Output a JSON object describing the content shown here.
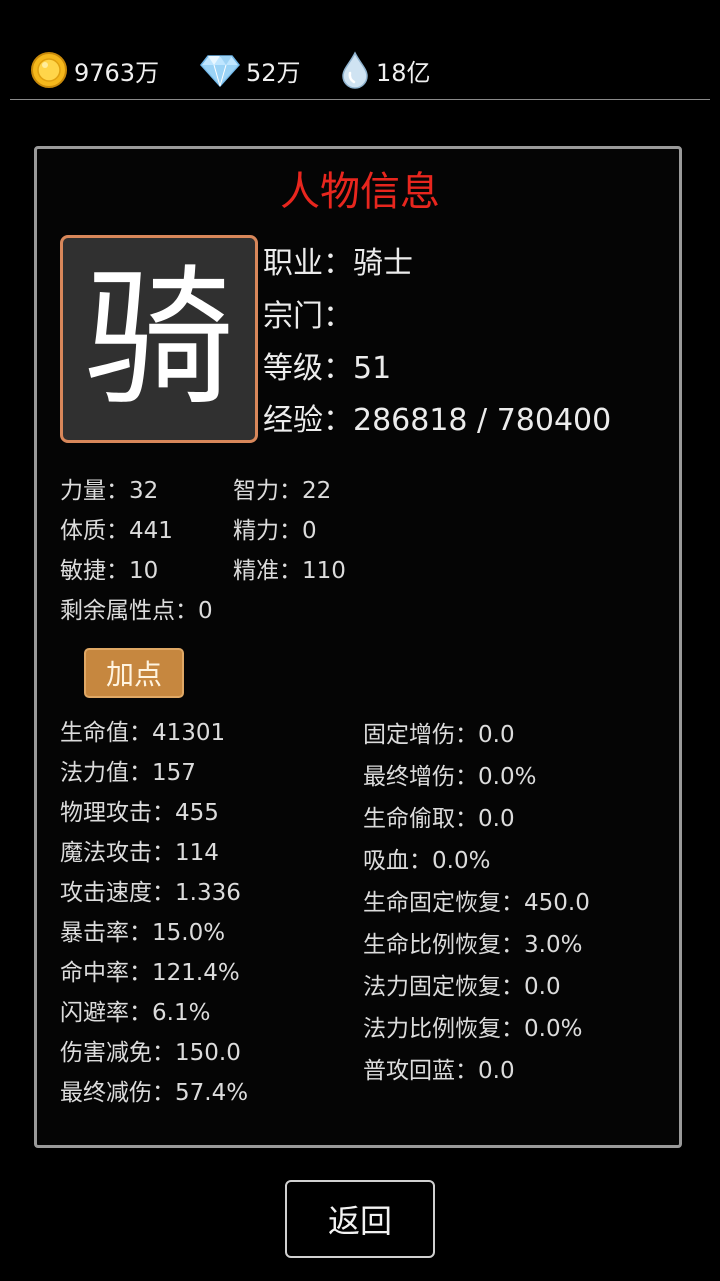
{
  "resources": {
    "gold": "9763万",
    "diamond": "52万",
    "water": "18亿"
  },
  "panel_title": "人物信息",
  "avatar_char": "骑",
  "profile": {
    "job": "职业：骑士",
    "sect": "宗门：",
    "level": "等级：51",
    "exp": "经验：286818 / 780400"
  },
  "attributes": {
    "strength": "力量：32",
    "intelligence": "智力：22",
    "constitution": "体质：441",
    "energy": "精力：0",
    "agility": "敏捷：10",
    "precision": "精准：110",
    "remaining": "剩余属性点：0"
  },
  "add_point_label": "加点",
  "combat_left": [
    "生命值：41301",
    "法力值：157",
    "物理攻击：455",
    "魔法攻击：114",
    "攻击速度：1.336",
    "暴击率：15.0%",
    "命中率：121.4%",
    "闪避率：6.1%",
    "伤害减免：150.0",
    "最终减伤：57.4%"
  ],
  "combat_right": [
    "固定增伤：0.0",
    "最终增伤：0.0%",
    "生命偷取：0.0",
    "吸血：0.0%",
    "生命固定恢复：450.0",
    "生命比例恢复：3.0%",
    "法力固定恢复：0.0",
    "法力比例恢复：0.0%",
    "普攻回蓝：0.0"
  ],
  "back_label": "返回",
  "icons": {
    "gold": "gold-coin-icon",
    "diamond": "diamond-icon",
    "water": "water-drop-icon"
  }
}
